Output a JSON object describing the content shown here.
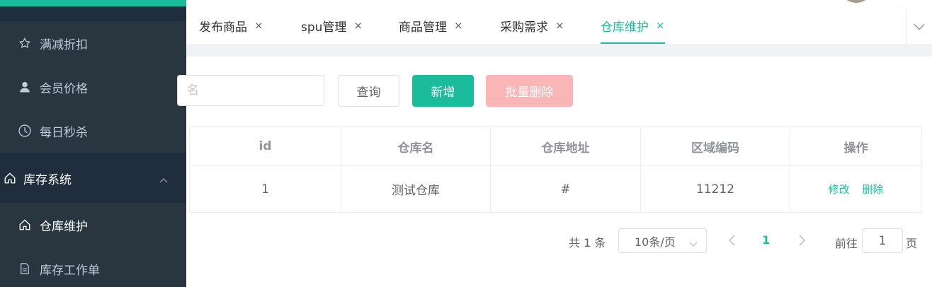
{
  "colors": {
    "accent": "#1abc9c",
    "sidebar_bg": "#1f2d3d",
    "submenu_bg": "#29353f",
    "danger_light": "#fab6b6"
  },
  "sidebar": {
    "items": [
      {
        "label": "满减折扣",
        "icon": "star-icon"
      },
      {
        "label": "会员价格",
        "icon": "user-icon"
      },
      {
        "label": "每日秒杀",
        "icon": "clock-icon"
      }
    ],
    "group": {
      "label": "库存系统",
      "icon": "home-icon",
      "expanded": true
    },
    "group_items": [
      {
        "label": "仓库维护",
        "icon": "home-icon",
        "active": true
      },
      {
        "label": "库存工作单",
        "icon": "document-icon",
        "active": false
      }
    ]
  },
  "tabs": [
    {
      "label": "发布商品",
      "active": false
    },
    {
      "label": "spu管理",
      "active": false
    },
    {
      "label": "商品管理",
      "active": false
    },
    {
      "label": "采购需求",
      "active": false
    },
    {
      "label": "仓库维护",
      "active": true
    }
  ],
  "tab_close_glyph": "×",
  "toolbar": {
    "search_placeholder": "名",
    "search_value": "",
    "query_label": "查询",
    "add_label": "新增",
    "batch_delete_label": "批量删除"
  },
  "table": {
    "columns": [
      "id",
      "仓库名",
      "仓库地址",
      "区域编码",
      "操作"
    ],
    "rows": [
      {
        "id": "1",
        "name": "测试仓库",
        "address": "#",
        "area_code": "11212"
      }
    ],
    "actions": {
      "edit": "修改",
      "delete": "删除"
    }
  },
  "pagination": {
    "total_text": "共 1 条",
    "page_size": "10条/页",
    "current_page": "1",
    "goto_label": "前往",
    "goto_value": "1",
    "page_suffix": "页"
  }
}
